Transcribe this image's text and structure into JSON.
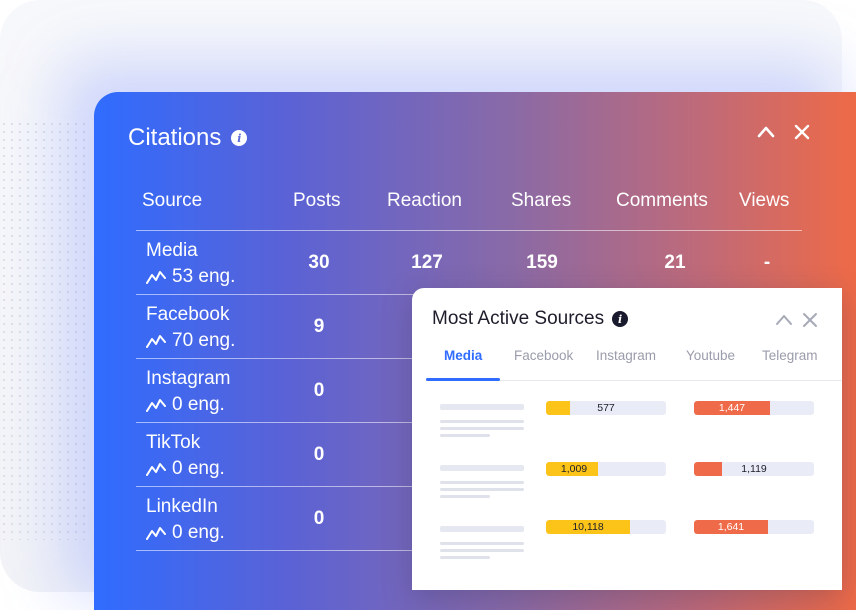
{
  "citations": {
    "title": "Citations",
    "columns": [
      "Source",
      "Posts",
      "Reaction",
      "Shares",
      "Comments",
      "Views"
    ],
    "rows": [
      {
        "source": "Media",
        "eng": "53 eng.",
        "posts": "30",
        "reaction": "127",
        "shares": "159",
        "comments": "21",
        "views": "-"
      },
      {
        "source": "Facebook",
        "eng": "70 eng.",
        "posts": "9"
      },
      {
        "source": "Instagram",
        "eng": "0 eng.",
        "posts": "0"
      },
      {
        "source": "TikTok",
        "eng": "0 eng.",
        "posts": "0"
      },
      {
        "source": "LinkedIn",
        "eng": "0 eng.",
        "posts": "0"
      }
    ]
  },
  "most_active": {
    "title": "Most Active Sources",
    "tabs": [
      "Media",
      "Facebook",
      "Instagram",
      "Youtube",
      "Telegram"
    ],
    "active_tab": "Media",
    "bars": [
      {
        "yellow_label": "577",
        "yellow_fill": 0.2,
        "red_label": "1,447",
        "red_fill": 0.63
      },
      {
        "yellow_label": "1,009",
        "yellow_fill": 0.43,
        "red_label": "1,119",
        "red_fill": 0.23
      },
      {
        "yellow_label": "10,118",
        "yellow_fill": 0.7,
        "red_label": "1,641",
        "red_fill": 0.62
      }
    ]
  },
  "colors": {
    "accent": "#2f6cff",
    "yellow": "#fcc419",
    "red": "#ef6a48"
  }
}
